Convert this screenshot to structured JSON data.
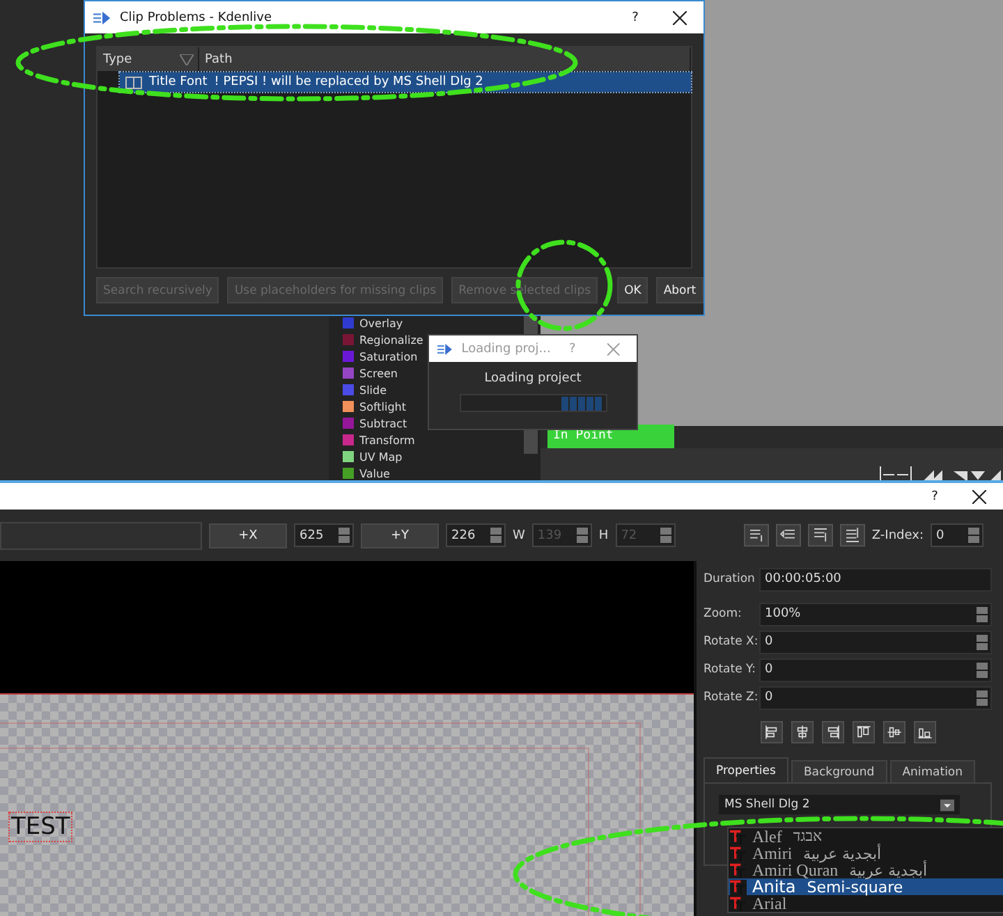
{
  "clip_problems_dialog": {
    "title": "Clip Problems - Kdenlive",
    "help": "?",
    "columns": [
      "Type",
      "Path"
    ],
    "rows": [
      {
        "type": "Title Font",
        "path": "! PEPSI ! will be replaced by MS Shell Dlg 2",
        "selected": true
      }
    ],
    "buttons": [
      {
        "label": "Search recursively",
        "disabled": true
      },
      {
        "label": "Use placeholders for missing clips",
        "disabled": true
      },
      {
        "label": "Remove selected clips",
        "disabled": true
      },
      {
        "label": "OK",
        "disabled": false
      },
      {
        "label": "Abort",
        "disabled": false
      }
    ]
  },
  "effects": [
    {
      "name": "Overlay",
      "color": "#2f3bd0"
    },
    {
      "name": "Regionalize",
      "color": "#7a1535"
    },
    {
      "name": "Saturation",
      "color": "#6a18d8"
    },
    {
      "name": "Screen",
      "color": "#9445c4"
    },
    {
      "name": "Slide",
      "color": "#4b4be6"
    },
    {
      "name": "Softlight",
      "color": "#f0905a"
    },
    {
      "name": "Subtract",
      "color": "#96169a"
    },
    {
      "name": "Transform",
      "color": "#c8288c"
    },
    {
      "name": "UV Map",
      "color": "#7fd47f"
    },
    {
      "name": "Value",
      "color": "#45a025"
    }
  ],
  "loading_dialog": {
    "title": "Loading proj...",
    "help": "?",
    "message": "Loading project"
  },
  "monitor": {
    "marker": "In Point"
  },
  "title_window": {
    "help": "?",
    "toolbar": [
      {
        "kind": "button",
        "label": "+X"
      },
      {
        "kind": "spin",
        "value": "625",
        "disabled": false
      },
      {
        "kind": "button",
        "label": "+Y"
      },
      {
        "kind": "spin",
        "value": "226",
        "disabled": false
      },
      {
        "kind": "label",
        "label": "W"
      },
      {
        "kind": "spin",
        "value": "139",
        "disabled": true
      },
      {
        "kind": "label",
        "label": "H"
      },
      {
        "kind": "spin",
        "value": "72",
        "disabled": true
      }
    ],
    "z_index": {
      "label": "Z-Index:",
      "value": "0"
    },
    "canvas": {
      "text": "TEST"
    },
    "fields": [
      {
        "kind": "text",
        "label": "Duration",
        "value": "00:00:05:00"
      },
      {
        "kind": "spin",
        "label": "Zoom:",
        "value": "100%"
      },
      {
        "kind": "spin",
        "label": "Rotate X:",
        "value": "0"
      },
      {
        "kind": "spin",
        "label": "Rotate Y:",
        "value": "0"
      },
      {
        "kind": "spin",
        "label": "Rotate Z:",
        "value": "0"
      }
    ],
    "tabs": [
      {
        "label": "Properties",
        "selected": true
      },
      {
        "label": "Background",
        "selected": false
      },
      {
        "label": "Animation",
        "selected": false
      }
    ],
    "font_select": "MS Shell Dlg 2",
    "fonts": [
      {
        "name": "Alef",
        "sample": "אבגד",
        "selected": false
      },
      {
        "name": "Amiri",
        "sample": "أبجدية عربية",
        "selected": false
      },
      {
        "name": "Amiri Quran",
        "sample": "أبجدية عربية",
        "selected": false
      },
      {
        "name": "Anita",
        "sample": "Semi-square",
        "selected": true
      },
      {
        "name": "Arial",
        "selected": false
      }
    ]
  }
}
